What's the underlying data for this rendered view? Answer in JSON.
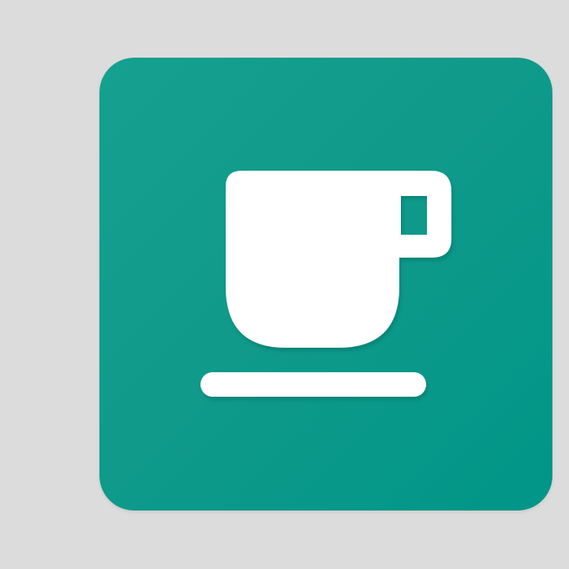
{
  "page": {
    "background_color": "#dcdcdc"
  },
  "app_icon": {
    "icon": "coffee-cup-icon",
    "tile_color": "#009688",
    "glyph_color": "#ffffff"
  }
}
